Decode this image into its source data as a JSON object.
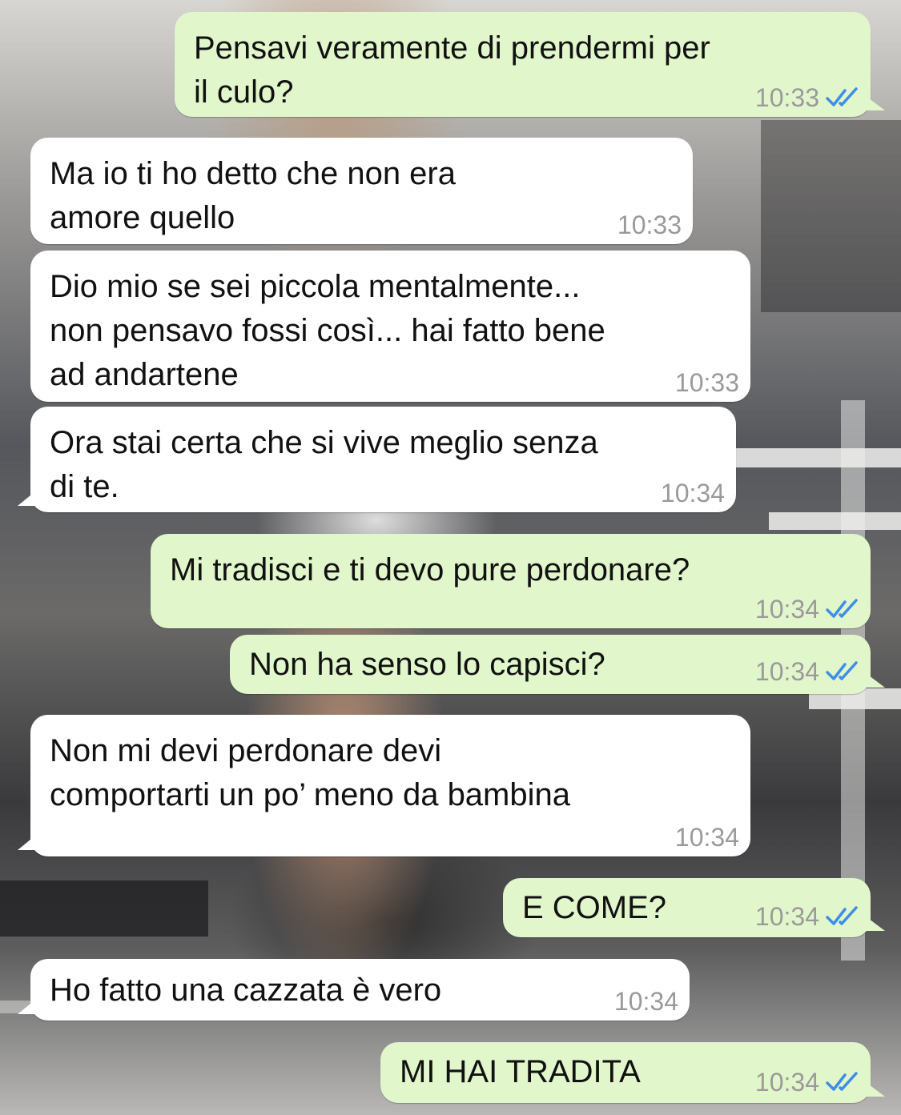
{
  "chat": {
    "messages": [
      {
        "direction": "out",
        "text": "Pensavi veramente di prendermi per\nil culo?",
        "time": "10:33",
        "status": "read-ticks-icon"
      },
      {
        "direction": "in",
        "text": "Ma io ti ho detto che non era\namore quello",
        "time": "10:33"
      },
      {
        "direction": "in",
        "text": "Dio mio se sei piccola mentalmente...\nnon pensavo fossi così... hai fatto bene\nad andartene",
        "time": "10:33"
      },
      {
        "direction": "in",
        "text": "Ora stai certa che si vive meglio senza\ndi te.",
        "time": "10:34"
      },
      {
        "direction": "out",
        "text": "Mi tradisci e ti devo pure perdonare?",
        "time": "10:34",
        "status": "read-ticks-icon"
      },
      {
        "direction": "out",
        "text": "Non ha senso lo capisci?",
        "time": "10:34",
        "status": "read-ticks-icon"
      },
      {
        "direction": "in",
        "text": "Non mi devi perdonare devi\ncomportarti un po’ meno da bambina",
        "time": "10:34"
      },
      {
        "direction": "out",
        "text": "E COME?",
        "time": "10:34",
        "status": "read-ticks-icon"
      },
      {
        "direction": "in",
        "text": "Ho fatto una cazzata è vero",
        "time": "10:34"
      },
      {
        "direction": "out",
        "text": "MI HAI TRADITA",
        "time": "10:34",
        "status": "read-ticks-icon"
      }
    ]
  },
  "colors": {
    "incoming_bubble": "#ffffff",
    "outgoing_bubble": "#e1f6cb",
    "read_ticks": "#3d8ee8",
    "timestamp": "#9a9a9a"
  }
}
